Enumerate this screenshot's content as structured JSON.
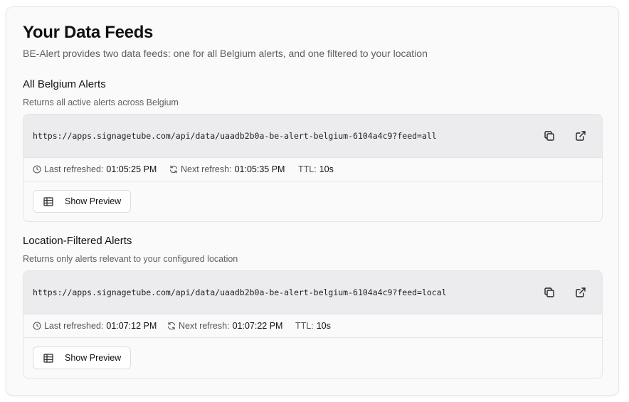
{
  "header": {
    "title": "Your Data Feeds",
    "subtitle": "BE-Alert provides two data feeds: one for all Belgium alerts, and one filtered to your location"
  },
  "feeds": [
    {
      "title": "All Belgium Alerts",
      "description": "Returns all active alerts across Belgium",
      "url": "https://apps.signagetube.com/api/data/uaadb2b0a-be-alert-belgium-6104a4c9?feed=all",
      "last_refreshed_label": "Last refreshed:",
      "last_refreshed_value": "01:05:25 PM",
      "next_refresh_label": "Next refresh:",
      "next_refresh_value": "01:05:35 PM",
      "ttl_label": "TTL:",
      "ttl_value": "10s",
      "preview_label": "Show Preview"
    },
    {
      "title": "Location-Filtered Alerts",
      "description": "Returns only alerts relevant to your configured location",
      "url": "https://apps.signagetube.com/api/data/uaadb2b0a-be-alert-belgium-6104a4c9?feed=local",
      "last_refreshed_label": "Last refreshed:",
      "last_refreshed_value": "01:07:12 PM",
      "next_refresh_label": "Next refresh:",
      "next_refresh_value": "01:07:22 PM",
      "ttl_label": "TTL:",
      "ttl_value": "10s",
      "preview_label": "Show Preview"
    }
  ],
  "icons": {
    "copy": "copy-icon",
    "open": "external-link-icon",
    "clock": "clock-icon",
    "refresh": "refresh-icon",
    "table": "table-icon"
  }
}
